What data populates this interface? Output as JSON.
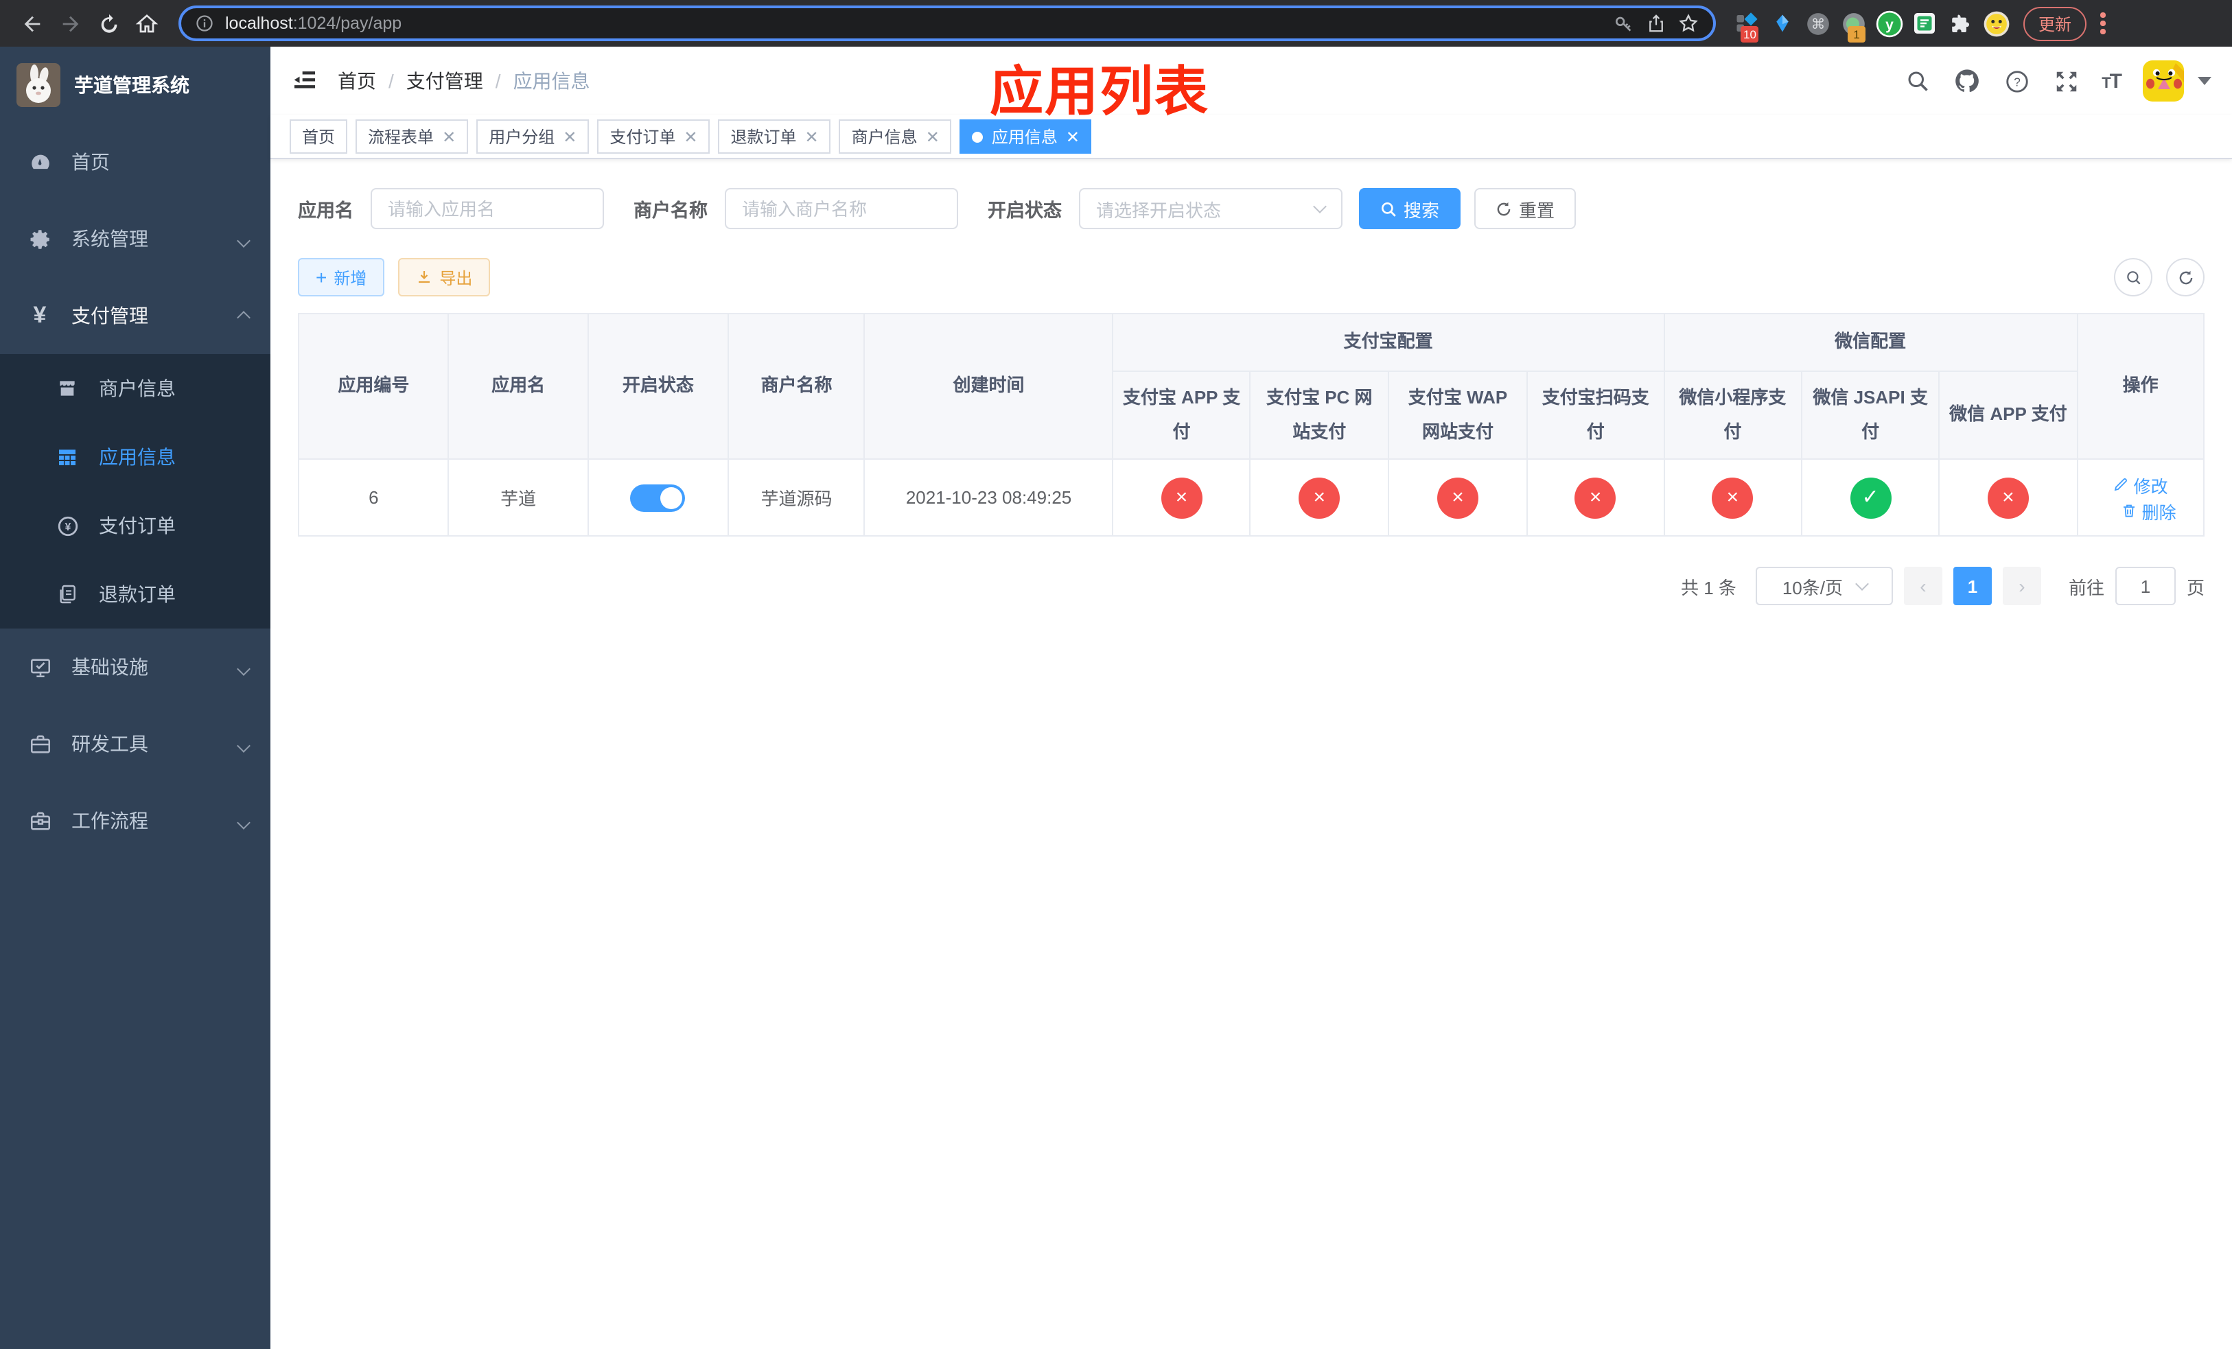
{
  "browser": {
    "url": {
      "host": "localhost",
      "path": ":1024/pay/app"
    },
    "update_button": "更新",
    "extension_badges": {
      "first": "10",
      "second": "1"
    }
  },
  "sidebar": {
    "title": "芋道管理系统",
    "items": [
      {
        "label": "首页"
      },
      {
        "label": "系统管理"
      },
      {
        "label": "支付管理"
      },
      {
        "label": "商户信息"
      },
      {
        "label": "应用信息"
      },
      {
        "label": "支付订单"
      },
      {
        "label": "退款订单"
      },
      {
        "label": "基础设施"
      },
      {
        "label": "研发工具"
      },
      {
        "label": "工作流程"
      }
    ]
  },
  "breadcrumb": {
    "items": [
      "首页",
      "支付管理",
      "应用信息"
    ]
  },
  "annotation": "应用列表",
  "tabs": [
    {
      "label": "首页"
    },
    {
      "label": "流程表单"
    },
    {
      "label": "用户分组"
    },
    {
      "label": "支付订单"
    },
    {
      "label": "退款订单"
    },
    {
      "label": "商户信息"
    },
    {
      "label": "应用信息"
    }
  ],
  "filters": {
    "app_name": {
      "label": "应用名",
      "placeholder": "请输入应用名"
    },
    "merchant_name": {
      "label": "商户名称",
      "placeholder": "请输入商户名称"
    },
    "status": {
      "label": "开启状态",
      "placeholder": "请选择开启状态"
    },
    "search_button": "搜索",
    "reset_button": "重置"
  },
  "toolbar": {
    "add_button": "新增",
    "export_button": "导出"
  },
  "table": {
    "columns": {
      "app_id": "应用编号",
      "app_name": "应用名",
      "status": "开启状态",
      "merchant": "商户名称",
      "created": "创建时间",
      "alipay_group": "支付宝配置",
      "alipay_app": "支付宝 APP 支付",
      "alipay_pc": "支付宝 PC 网站支付",
      "alipay_wap": "支付宝 WAP 网站支付",
      "alipay_qr": "支付宝扫码支付",
      "wechat_group": "微信配置",
      "wechat_mini": "微信小程序支付",
      "wechat_jsapi": "微信 JSAPI 支付",
      "wechat_app": "微信 APP 支付",
      "actions": "操作"
    },
    "row": {
      "app_id": "6",
      "app_name": "芋道",
      "enabled": true,
      "merchant": "芋道源码",
      "created": "2021-10-23 08:49:25",
      "statuses": [
        false,
        false,
        false,
        false,
        false,
        true,
        false
      ],
      "edit_label": "修改",
      "delete_label": "删除"
    }
  },
  "pagination": {
    "total": "共 1 条",
    "page_size": "10条/页",
    "current_page": "1",
    "goto_label": "前往",
    "goto_value": "1",
    "page_suffix": "页"
  },
  "colors": {
    "accent": "#409eff",
    "danger": "#f4504d",
    "success": "#15c363",
    "annotation": "#fa2b0d"
  }
}
